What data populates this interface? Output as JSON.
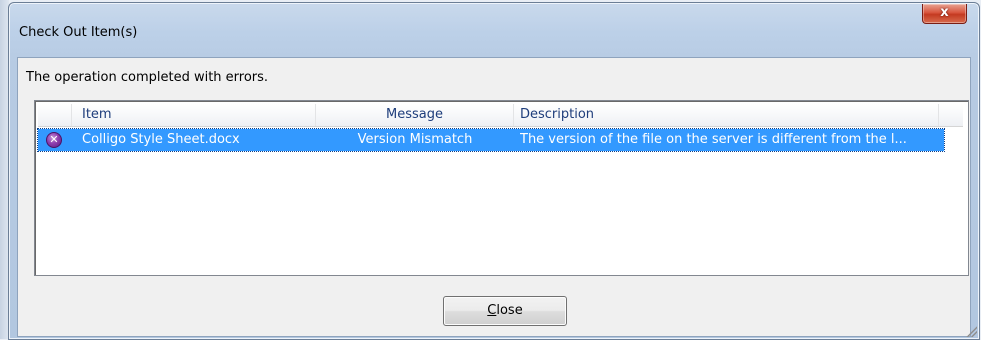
{
  "window": {
    "title": "Check Out Item(s)",
    "close_glyph": "x"
  },
  "status_message": "The operation completed with errors.",
  "list": {
    "columns": [
      "Item",
      "Message",
      "Description"
    ],
    "rows": [
      {
        "icon": "error-icon",
        "item": "Colligo Style Sheet.docx",
        "message": "Version Mismatch",
        "description": "The version of the file on the server is different from the l...",
        "selected": true
      }
    ]
  },
  "buttons": {
    "close_label_first": "C",
    "close_label_rest": "lose"
  },
  "colors": {
    "selection": "#3399ff",
    "header_text": "#1e3d7b",
    "close_x": "#c43a21"
  }
}
